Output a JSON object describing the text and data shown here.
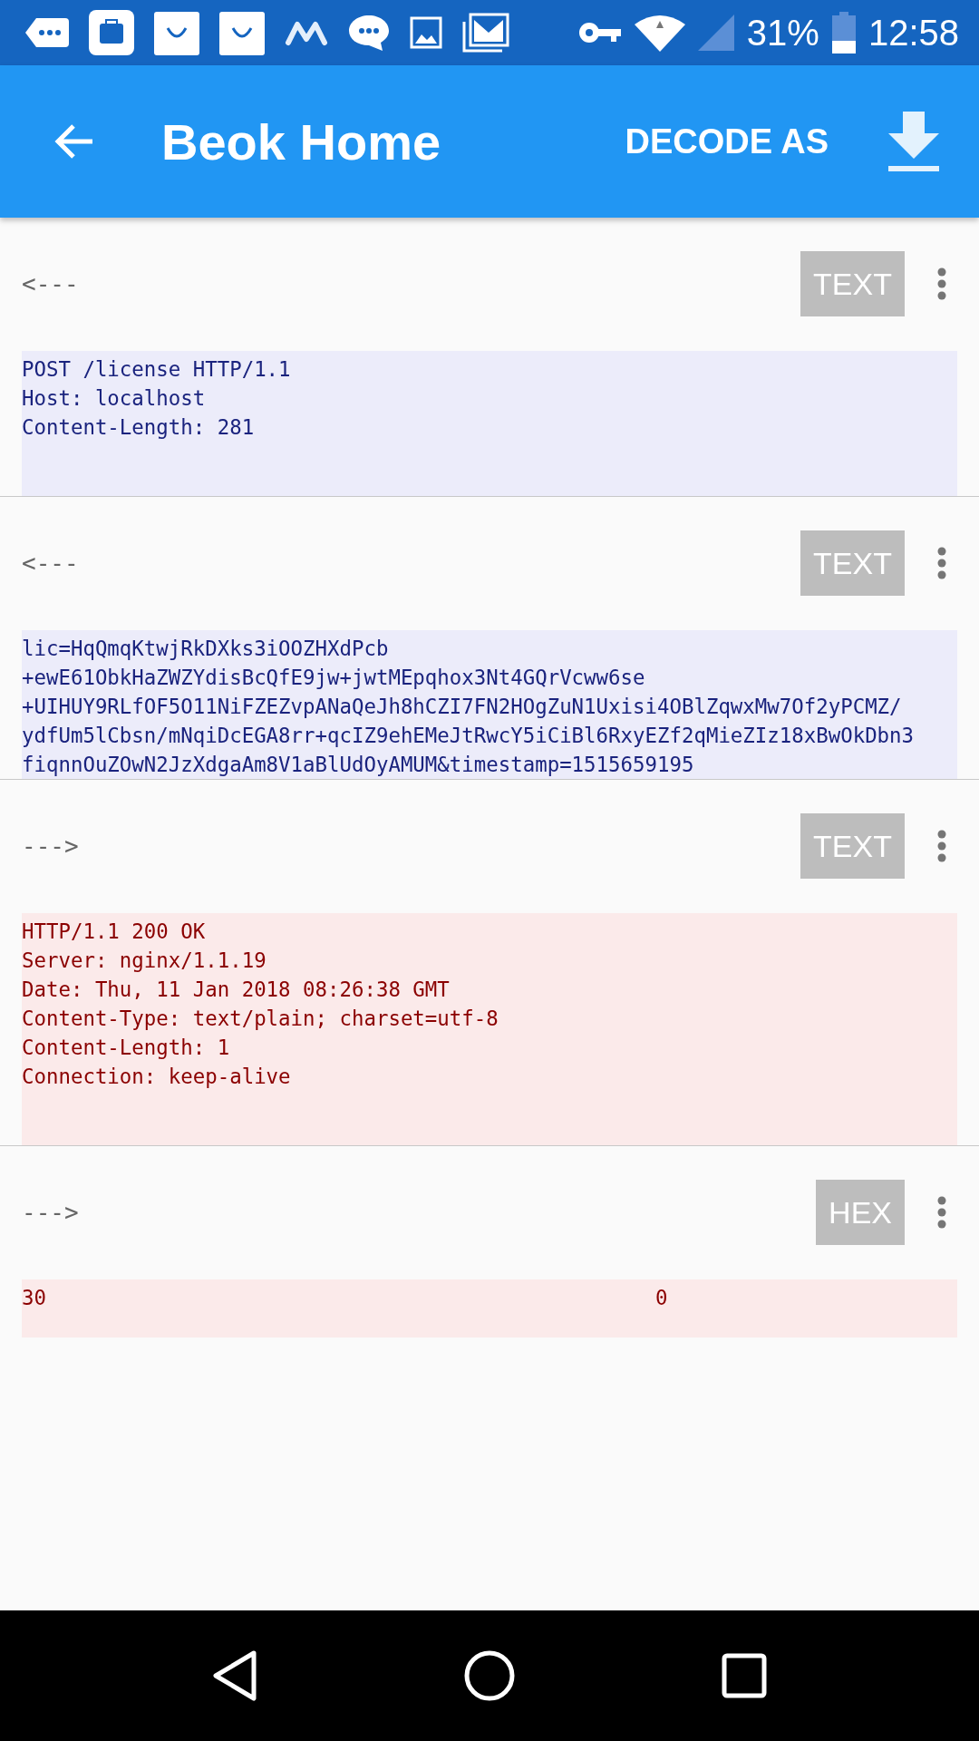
{
  "status_bar": {
    "battery": "31%",
    "time": "12:58"
  },
  "app_bar": {
    "title": "Beok Home",
    "action": "DECODE AS"
  },
  "messages": [
    {
      "direction": "<---",
      "format": "TEXT",
      "kind": "request",
      "lines": [
        "POST /license HTTP/1.1",
        "Host: localhost",
        "Content-Length: 281"
      ]
    },
    {
      "direction": "<---",
      "format": "TEXT",
      "kind": "request",
      "lines": [
        "lic=HqQmqKtwjRkDXks3iOOZHXdPcb",
        "+ewE61ObkHaZWZYdisBcQfE9jw+jwtMEpqhox3Nt4GQrVcww6se",
        "+UIHUY9RLfOF5O11NiFZEZvpANaQeJh8hCZI7FN2HOgZuN1Uxisi4OBlZqwxMw7Of2yPCMZ/",
        "ydfUm5lCbsn/mNqiDcEGA8rr+qcIZ9ehEMeJtRwcY5iCiBl6RxyEZf2qMieZIz18xBwOkDbn3",
        "fiqnnOuZOwN2JzXdgaAm8V1aBlUdOyAMUM&timestamp=1515659195"
      ]
    },
    {
      "direction": "--->",
      "format": "TEXT",
      "kind": "response",
      "lines": [
        "HTTP/1.1 200 OK",
        "Server: nginx/1.1.19",
        "Date: Thu, 11 Jan 2018 08:26:38 GMT",
        "Content-Type: text/plain; charset=utf-8",
        "Content-Length: 1",
        "Connection: keep-alive"
      ]
    },
    {
      "direction": "--->",
      "format": "HEX",
      "kind": "response",
      "hex_rows": [
        {
          "hex": "30",
          "ascii": "0"
        }
      ]
    }
  ]
}
